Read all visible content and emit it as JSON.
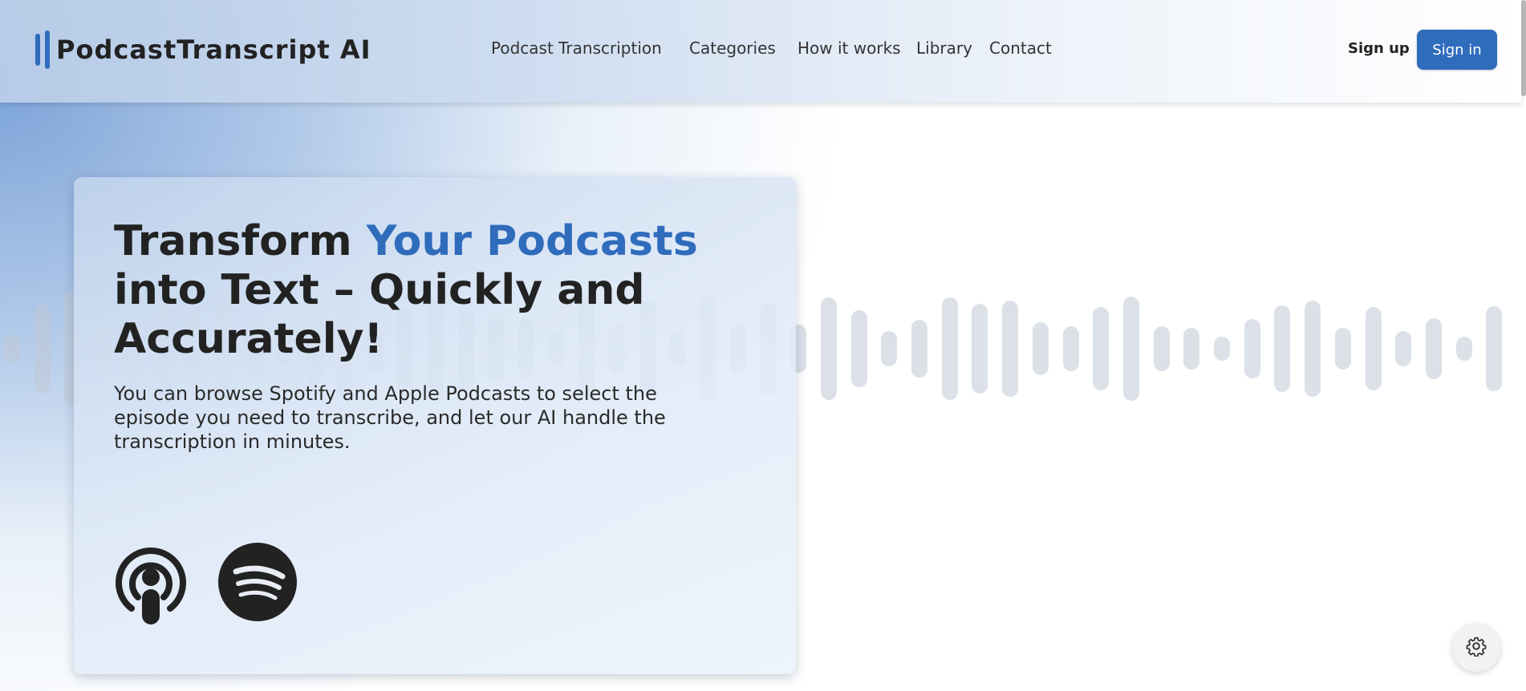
{
  "header": {
    "logo_text": "PodcastTranscript AI",
    "nav": [
      {
        "label": "Podcast Transcription"
      },
      {
        "label": "Categories"
      },
      {
        "label": "How it works"
      },
      {
        "label": "Library"
      },
      {
        "label": "Contact"
      }
    ],
    "signup_label": "Sign up",
    "signin_label": "Sign in"
  },
  "hero": {
    "title_part1": "Transform ",
    "title_accent": "Your Podcasts",
    "title_part2": "into Text – Quickly and Accurately!",
    "description": "You can browse Spotify and Apple Podcasts to select the episode you need to transcribe, and let our AI handle the transcription in minutes.",
    "platforms": [
      {
        "name": "apple-podcasts-icon"
      },
      {
        "name": "spotify-icon"
      }
    ]
  },
  "settings": {
    "icon": "gear-icon"
  },
  "colors": {
    "accent": "#2f6cbc",
    "text": "#222222",
    "waveform": "#bfc9d6"
  }
}
